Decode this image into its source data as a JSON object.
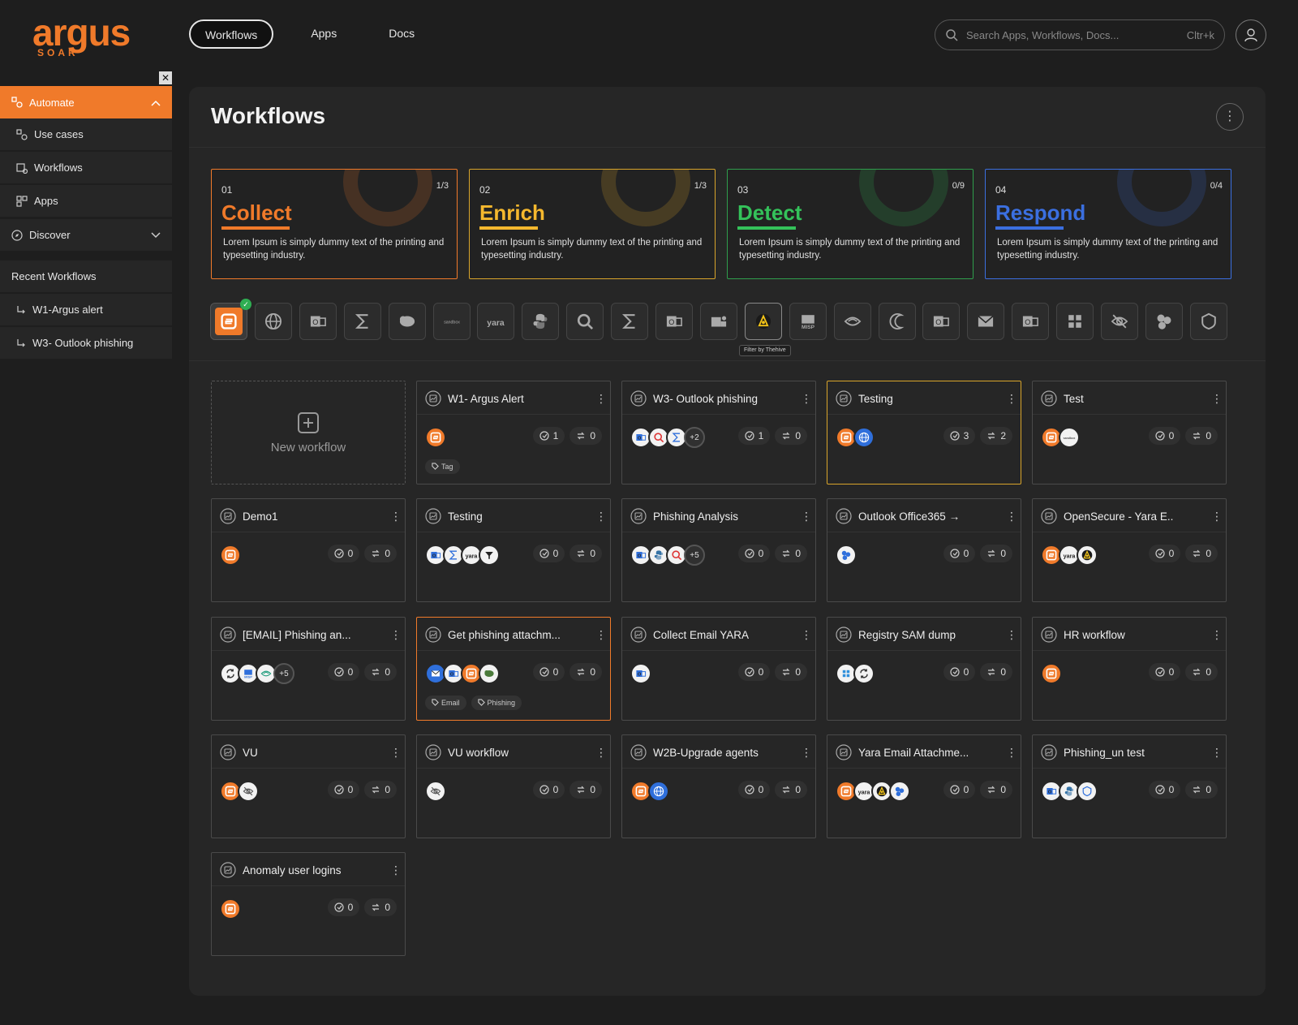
{
  "app": {
    "logo_text": "argus",
    "logo_sub": "SOAR"
  },
  "nav": {
    "tabs": [
      {
        "label": "Workflows",
        "active": true
      },
      {
        "label": "Apps",
        "active": false
      },
      {
        "label": "Docs",
        "active": false
      }
    ],
    "search_placeholder": "Search Apps, Workflows, Docs...",
    "search_shortcut": "Cltr+k"
  },
  "sidebar": {
    "close_glyph": "✕",
    "automate": "Automate",
    "items": [
      {
        "label": "Use cases",
        "icon": "use-cases-icon"
      },
      {
        "label": "Workflows",
        "icon": "workflows-icon"
      },
      {
        "label": "Apps",
        "icon": "apps-icon"
      }
    ],
    "discover": "Discover",
    "recent_title": "Recent Workflows",
    "recent": [
      "W1-Argus alert",
      "W3- Outlook phishing"
    ]
  },
  "page": {
    "title": "Workflows",
    "menu_glyph": "⋮"
  },
  "stages": [
    {
      "num": "01",
      "title": "Collect",
      "count": "1/3",
      "desc": "Lorem Ipsum is simply dummy text of the printing and typesetting industry.",
      "color": "#f07a2a",
      "border": "#f07a2a"
    },
    {
      "num": "02",
      "title": "Enrich",
      "count": "1/3",
      "desc": "Lorem Ipsum is simply dummy text of the printing and typesetting industry.",
      "color": "#f5b82e",
      "border": "#d9a52b"
    },
    {
      "num": "03",
      "title": "Detect",
      "count": "0/9",
      "desc": "Lorem Ipsum is simply dummy text of the printing and typesetting industry.",
      "color": "#34c25a",
      "border": "#2f9e4c"
    },
    {
      "num": "04",
      "title": "Respond",
      "count": "0/4",
      "desc": "Lorem Ipsum is simply dummy text of the printing and typesetting industry.",
      "color": "#3b6fe0",
      "border": "#3b6fe0"
    }
  ],
  "integrations": {
    "tooltip": "Filter by Thehive",
    "icons": [
      "argus-icon",
      "globe-icon",
      "outlook-icon",
      "sigma-icon",
      "elephant-icon",
      "sandbox-icon",
      "yara-icon",
      "python-icon",
      "magnifier-icon",
      "sigma-icon",
      "outlook-icon",
      "teams-icon",
      "thehive-icon",
      "misp-icon",
      "wave-icon",
      "crescent-icon",
      "outlook-icon",
      "mail-icon",
      "outlook-icon",
      "windows-icon",
      "eye-off-icon",
      "hexagons-icon",
      "shield-icon"
    ]
  },
  "new_workflow": "New workflow",
  "workflows": [
    {
      "name": "W1- Argus Alert",
      "icons": [
        "argus"
      ],
      "more": "",
      "runs": "1",
      "shares": "0",
      "tags": [
        "Tag"
      ],
      "border": "#4a4a4a"
    },
    {
      "name": "W3- Outlook phishing",
      "icons": [
        "outlook",
        "search",
        "sigma"
      ],
      "more": "+2",
      "runs": "1",
      "shares": "0",
      "tags": [],
      "border": "#4a4a4a"
    },
    {
      "name": "Testing",
      "icons": [
        "argus",
        "globe"
      ],
      "more": "",
      "runs": "3",
      "shares": "2",
      "tags": [],
      "border": "#d9a52b"
    },
    {
      "name": "Test",
      "icons": [
        "argus",
        "sandbox"
      ],
      "more": "",
      "runs": "0",
      "shares": "0",
      "tags": [],
      "border": "#4a4a4a"
    },
    {
      "name": "Demo1",
      "icons": [
        "argus"
      ],
      "more": "",
      "runs": "0",
      "shares": "0",
      "tags": [],
      "border": "#4a4a4a"
    },
    {
      "name": "Testing",
      "icons": [
        "outlook",
        "sigma",
        "yara",
        "filter"
      ],
      "more": "",
      "runs": "0",
      "shares": "0",
      "tags": [],
      "border": "#4a4a4a"
    },
    {
      "name": "Phishing Analysis",
      "icons": [
        "outlook",
        "python",
        "search"
      ],
      "more": "+5",
      "runs": "0",
      "shares": "0",
      "tags": [],
      "border": "#4a4a4a"
    },
    {
      "name": "Outlook Office365 →",
      "icons": [
        "hex"
      ],
      "more": "",
      "runs": "0",
      "shares": "0",
      "tags": [],
      "border": "#4a4a4a"
    },
    {
      "name": "OpenSecure - Yara E..",
      "icons": [
        "argus",
        "yara",
        "thehive"
      ],
      "more": "",
      "runs": "0",
      "shares": "0",
      "tags": [],
      "border": "#4a4a4a"
    },
    {
      "name": "[EMAIL] Phishing an...",
      "icons": [
        "sync",
        "misp",
        "wave"
      ],
      "more": "+5",
      "runs": "0",
      "shares": "0",
      "tags": [],
      "border": "#4a4a4a"
    },
    {
      "name": "Get phishing attachm...",
      "icons": [
        "mail",
        "outlook",
        "argus",
        "elephant"
      ],
      "more": "",
      "runs": "0",
      "shares": "0",
      "tags": [
        "Email",
        "Phishing"
      ],
      "border": "#f07a2a"
    },
    {
      "name": "Collect Email YARA",
      "icons": [
        "outlook"
      ],
      "more": "",
      "runs": "0",
      "shares": "0",
      "tags": [],
      "border": "#4a4a4a"
    },
    {
      "name": "Registry SAM dump",
      "icons": [
        "windows",
        "sync"
      ],
      "more": "",
      "runs": "0",
      "shares": "0",
      "tags": [],
      "border": "#4a4a4a"
    },
    {
      "name": "HR workflow",
      "icons": [
        "argus"
      ],
      "more": "",
      "runs": "0",
      "shares": "0",
      "tags": [],
      "border": "#4a4a4a"
    },
    {
      "name": "VU",
      "icons": [
        "argus",
        "eyeoff"
      ],
      "more": "",
      "runs": "0",
      "shares": "0",
      "tags": [],
      "border": "#4a4a4a"
    },
    {
      "name": "VU workflow",
      "icons": [
        "eyeoff"
      ],
      "more": "",
      "runs": "0",
      "shares": "0",
      "tags": [],
      "border": "#4a4a4a"
    },
    {
      "name": "W2B-Upgrade agents",
      "icons": [
        "argus",
        "globe"
      ],
      "more": "",
      "runs": "0",
      "shares": "0",
      "tags": [],
      "border": "#4a4a4a"
    },
    {
      "name": "Yara Email Attachme...",
      "icons": [
        "argus",
        "yara",
        "thehive",
        "hex"
      ],
      "more": "",
      "runs": "0",
      "shares": "0",
      "tags": [],
      "border": "#4a4a4a"
    },
    {
      "name": "Phishing_un test",
      "icons": [
        "outlook",
        "python",
        "shield"
      ],
      "more": "",
      "runs": "0",
      "shares": "0",
      "tags": [],
      "border": "#4a4a4a"
    },
    {
      "name": "Anomaly user logins",
      "icons": [
        "argus"
      ],
      "more": "",
      "runs": "0",
      "shares": "0",
      "tags": [],
      "border": "#4a4a4a"
    }
  ]
}
